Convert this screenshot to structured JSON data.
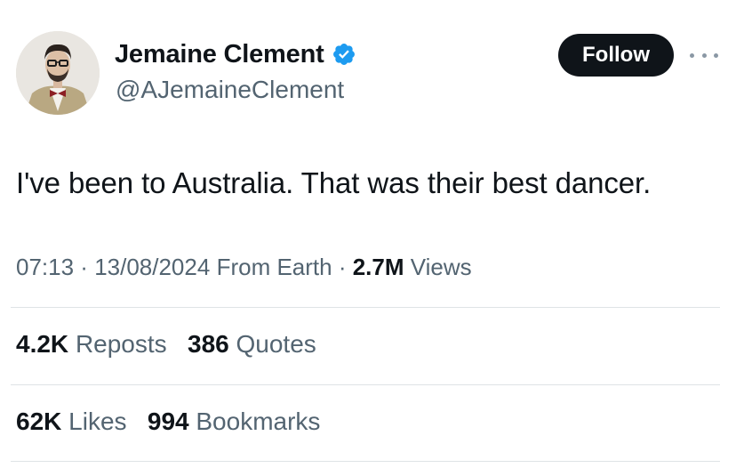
{
  "author": {
    "display_name": "Jemaine Clement",
    "handle": "@AJemaineClement",
    "verified_icon": "verified-badge-icon",
    "verified_color": "#1d9bf0"
  },
  "actions": {
    "follow_label": "Follow",
    "more_icon": "more-dots-icon"
  },
  "tweet": {
    "text": "I've been to Australia. That was their best dancer."
  },
  "meta": {
    "time": "07:13",
    "separator": " · ",
    "date": "13/08/2024",
    "source": "From Earth",
    "views_count": "2.7M",
    "views_label": "Views"
  },
  "stats": {
    "reposts_count": "4.2K",
    "reposts_label": "Reposts",
    "quotes_count": "386",
    "quotes_label": "Quotes",
    "likes_count": "62K",
    "likes_label": "Likes",
    "bookmarks_count": "994",
    "bookmarks_label": "Bookmarks"
  },
  "colors": {
    "text_primary": "#0f1419",
    "text_secondary": "#536471",
    "follow_bg": "#0f1419",
    "divider": "#dfe3e6"
  }
}
